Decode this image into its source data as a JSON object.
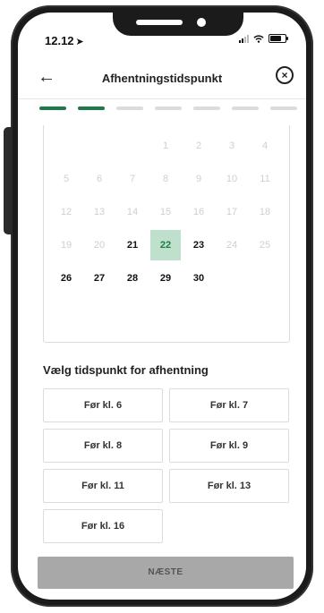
{
  "status": {
    "time": "12.12",
    "time_arrow": "➤"
  },
  "header": {
    "title": "Afhentningstidspunkt",
    "back_icon": "arrow-left-icon",
    "close_icon": "close-circle-icon"
  },
  "progress": {
    "total_steps": 7,
    "completed_steps": 2,
    "accent": "#1f7a4a"
  },
  "calendar": {
    "weeks": [
      [
        {
          "d": ""
        },
        {
          "d": ""
        },
        {
          "d": ""
        },
        {
          "d": "1",
          "s": "off"
        },
        {
          "d": "2",
          "s": "off"
        },
        {
          "d": "3",
          "s": "off"
        },
        {
          "d": "4",
          "s": "off"
        }
      ],
      [
        {
          "d": "5",
          "s": "off"
        },
        {
          "d": "6",
          "s": "off"
        },
        {
          "d": "7",
          "s": "off"
        },
        {
          "d": "8",
          "s": "off"
        },
        {
          "d": "9",
          "s": "off"
        },
        {
          "d": "10",
          "s": "off"
        },
        {
          "d": "11",
          "s": "off"
        }
      ],
      [
        {
          "d": "12",
          "s": "off"
        },
        {
          "d": "13",
          "s": "off"
        },
        {
          "d": "14",
          "s": "off"
        },
        {
          "d": "15",
          "s": "off"
        },
        {
          "d": "16",
          "s": "off"
        },
        {
          "d": "17",
          "s": "off"
        },
        {
          "d": "18",
          "s": "off"
        }
      ],
      [
        {
          "d": "19",
          "s": "off"
        },
        {
          "d": "20",
          "s": "off"
        },
        {
          "d": "21",
          "s": "on"
        },
        {
          "d": "22",
          "s": "selected"
        },
        {
          "d": "23",
          "s": "on"
        },
        {
          "d": "24",
          "s": "off"
        },
        {
          "d": "25",
          "s": "off"
        }
      ],
      [
        {
          "d": "26",
          "s": "on"
        },
        {
          "d": "27",
          "s": "on"
        },
        {
          "d": "28",
          "s": "on"
        },
        {
          "d": "29",
          "s": "on"
        },
        {
          "d": "30",
          "s": "on"
        },
        {
          "d": ""
        },
        {
          "d": ""
        }
      ]
    ],
    "selected_color": "#bfe0cc"
  },
  "timeslots": {
    "title": "Vælg tidspunkt for afhentning",
    "options": [
      "Før kl. 6",
      "Før kl. 7",
      "Før kl. 8",
      "Før kl. 9",
      "Før kl. 11",
      "Før kl. 13",
      "Før kl. 16"
    ]
  },
  "footer": {
    "next_label": "NÆSTE",
    "button_color": "#a8a8a8"
  }
}
